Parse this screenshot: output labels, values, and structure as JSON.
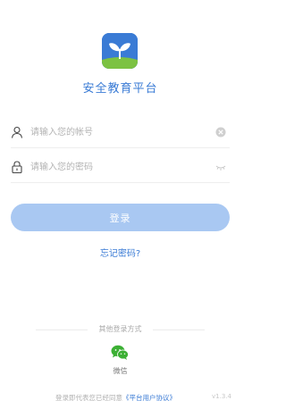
{
  "app": {
    "title": "安全教育平台",
    "brand_color": "#3a7bd5"
  },
  "account_field": {
    "placeholder": "请输入您的帐号",
    "value": "",
    "left_icon": "user-icon",
    "right_icon": "clear-icon"
  },
  "password_field": {
    "placeholder": "请输入您的密码",
    "value": "",
    "left_icon": "lock-icon",
    "right_icon": "eye-closed-icon"
  },
  "login_button": {
    "label": "登录",
    "color": "#a9c8f2"
  },
  "forgot_password": "忘记密码?",
  "other_login": {
    "title": "其他登录方式",
    "wechat_label": "微信",
    "wechat_color": "#3cb034"
  },
  "agreement": {
    "prefix": "登录即代表您已经同意",
    "link": "《平台用户协议》"
  },
  "version": "v1.3.4"
}
